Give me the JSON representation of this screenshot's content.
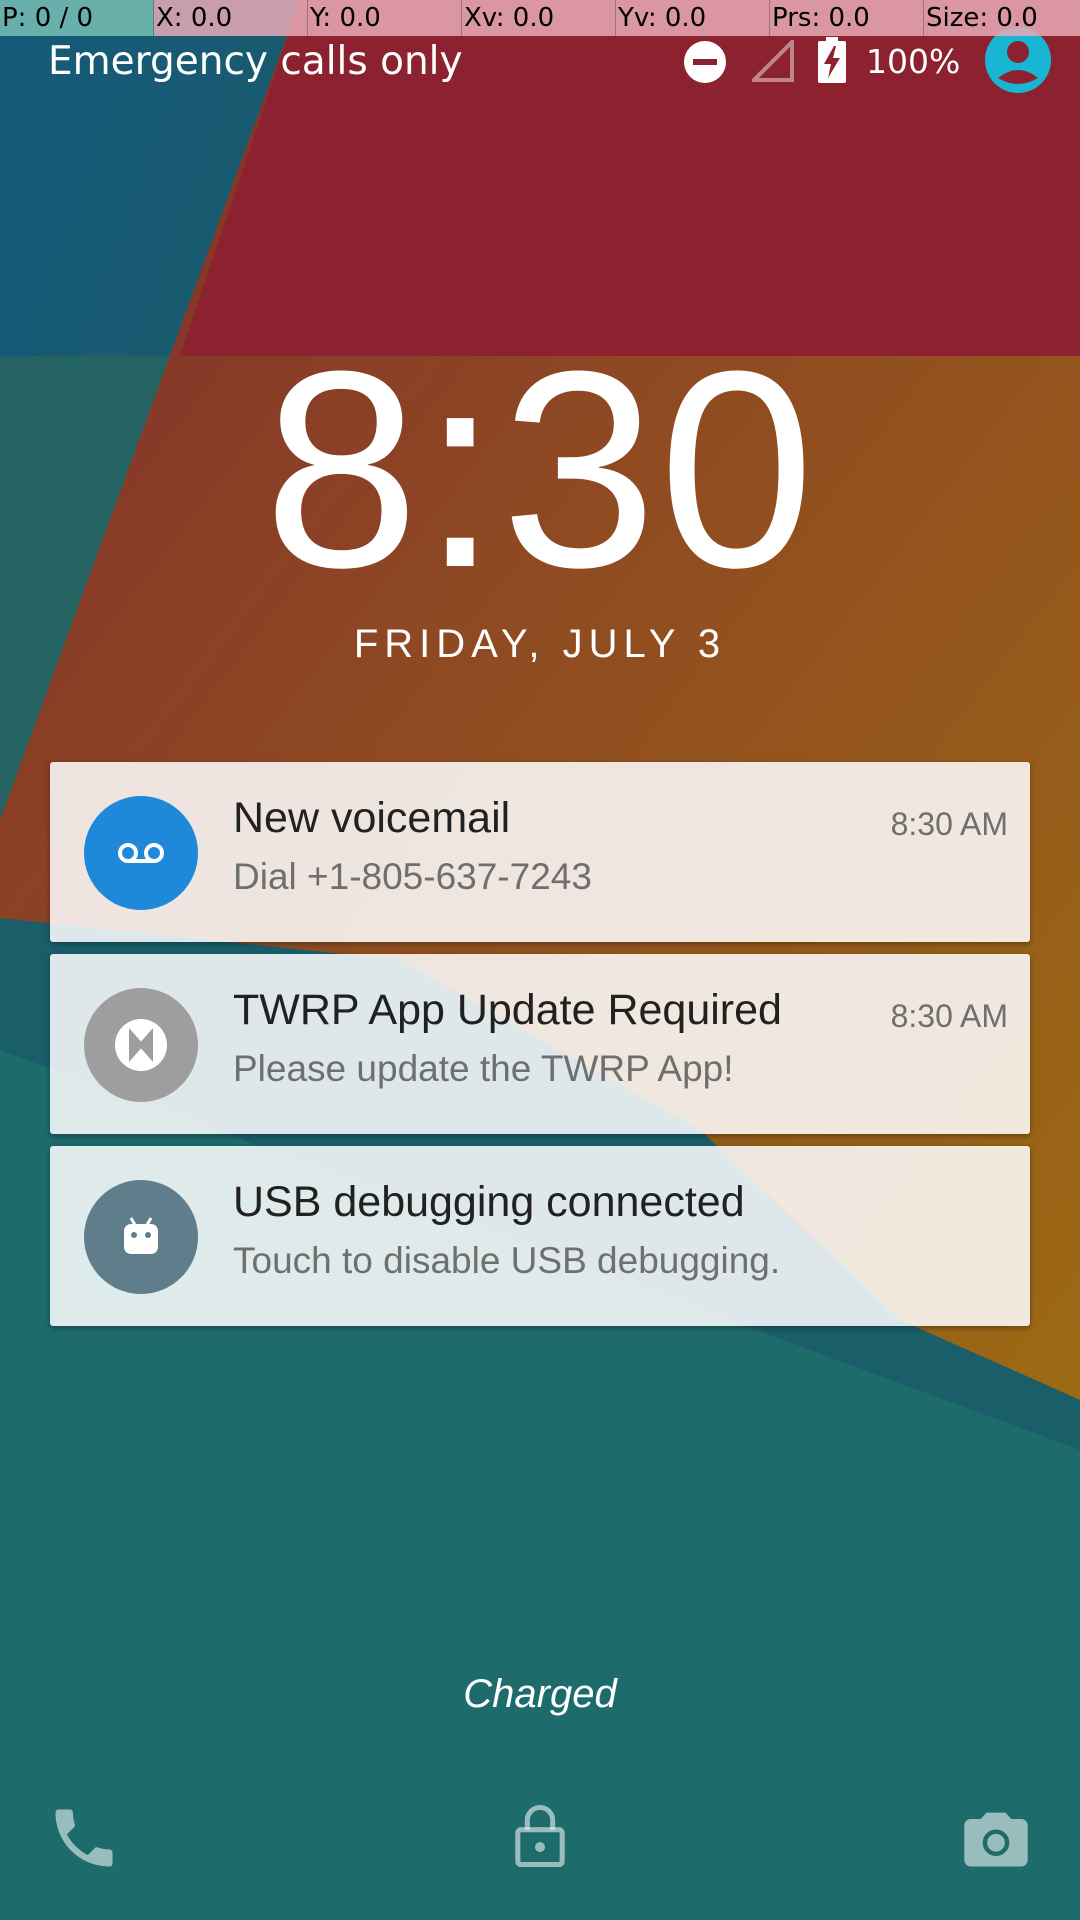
{
  "debug_bar": {
    "pointer": "P: 0 / 0",
    "x": "X: 0.0",
    "y": "Y: 0.0",
    "xv": "Xv: 0.0",
    "yv": "Yv: 0.0",
    "prs": "Prs: 0.0",
    "size": "Size: 0.0"
  },
  "status_bar": {
    "carrier": "Emergency calls only",
    "battery_percent": "100%",
    "icons": [
      "do-not-disturb-icon",
      "signal-icon",
      "battery-charging-icon",
      "user-avatar-icon"
    ]
  },
  "lockscreen": {
    "time": "8:30",
    "date": "FRIDAY, JULY 3",
    "charge_status": "Charged"
  },
  "notifications": [
    {
      "title": "New voicemail",
      "text": "Dial +1-805-637-7243",
      "time": "8:30 AM",
      "icon": "voicemail-icon",
      "icon_color": "#1e88d9"
    },
    {
      "title": "TWRP App Update Required",
      "text": "Please update the TWRP App!",
      "time": "8:30 AM",
      "icon": "twrp-icon",
      "icon_color": "#9e9e9e"
    },
    {
      "title": "USB debugging connected",
      "text": "Touch to disable USB debugging.",
      "time": "",
      "icon": "android-icon",
      "icon_color": "#607d8b"
    }
  ],
  "bottom_bar": {
    "left": "phone-icon",
    "center": "lock-icon",
    "right": "camera-icon"
  },
  "colors": {
    "wallpaper_red": "#8c222f",
    "wallpaper_teal": "#1e6b6c",
    "wallpaper_orange": "#a85c1e",
    "avatar": "#19b6d4"
  }
}
